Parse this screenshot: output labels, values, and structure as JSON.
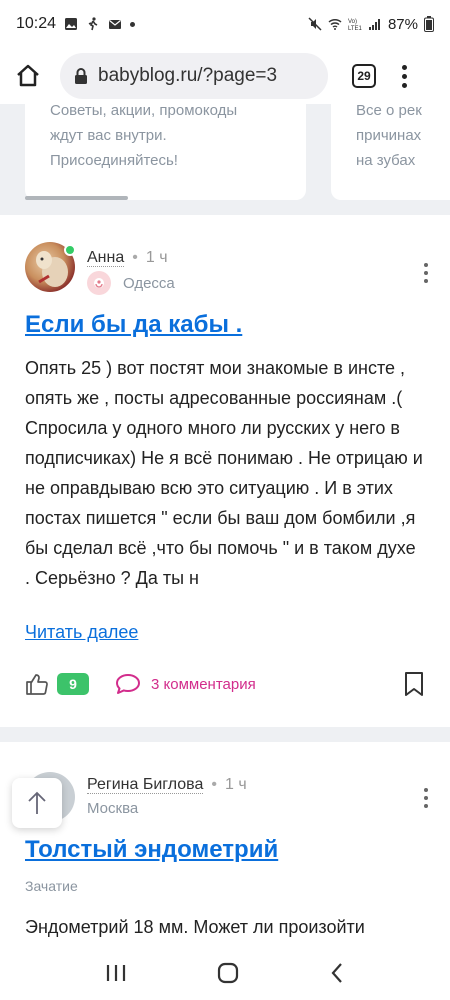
{
  "status": {
    "time": "10:24",
    "battery": "87%"
  },
  "browser": {
    "url": "babyblog.ru/?page=3",
    "tab_count": "29"
  },
  "promo": {
    "left_lines": [
      "Советы, акции, промокоды",
      "ждут вас внутри.",
      "Присоединяйтесь!"
    ],
    "right_lines": [
      "Все о рек",
      "причинах",
      "на зубах"
    ]
  },
  "posts": [
    {
      "author": "Анна",
      "time": "1 ч",
      "location": "Одесса",
      "title": "Если бы да кабы .",
      "body": "Опять 25 ) вот постят мои знакомые в инсте , опять же , посты адресованные россиянам .( Спросила у одного много ли русских у него в подписчиках) Не я всё понимаю . Не отрицаю и не оправдываю всю это ситуацию . И в этих постах пишется \" если бы ваш дом бомбили ,я бы сделал всё ,что бы помочь \" и в таком духе . Серьёзно ? Да ты н",
      "read_more": "Читать далее",
      "likes": "9",
      "comments": "3 комментария"
    },
    {
      "author": "Регина Биглова",
      "time": "1 ч",
      "location": "Москва",
      "title": "Толстый эндометрий",
      "category": "Зачатие",
      "body": "Эндометрий 18 мм. Может ли произойти"
    }
  ],
  "icons": {
    "home": "home-icon",
    "lock": "lock-icon",
    "like": "thumb-up-icon",
    "comment": "comment-bubble-icon",
    "bookmark": "bookmark-icon",
    "scroll_top": "arrow-up-icon"
  },
  "colors": {
    "link": "#0a6fdc",
    "like_badge": "#3cc36a",
    "comment": "#d22d8c",
    "muted": "#8b95a0"
  }
}
